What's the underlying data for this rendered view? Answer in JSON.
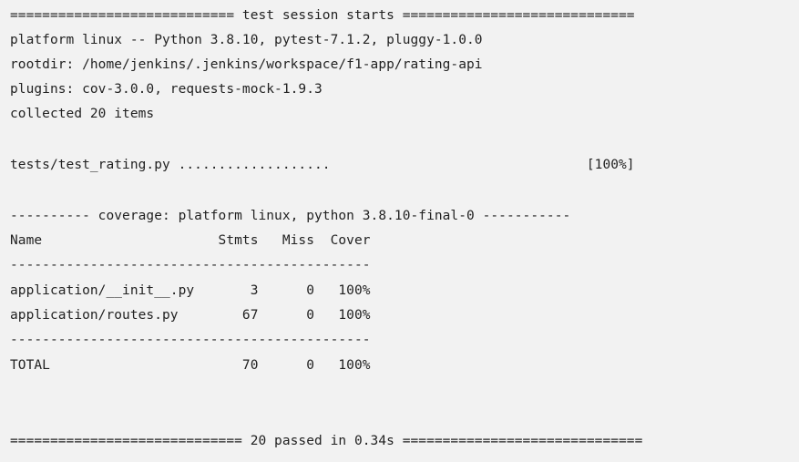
{
  "terminal": {
    "lines": [
      "============================ test session starts =============================",
      "platform linux -- Python 3.8.10, pytest-7.1.2, pluggy-1.0.0",
      "rootdir: /home/jenkins/.jenkins/workspace/f1-app/rating-api",
      "plugins: cov-3.0.0, requests-mock-1.9.3",
      "collected 20 items",
      "tests/test_rating.py ...................                                [100%]",
      "---------- coverage: platform linux, python 3.8.10-final-0 -----------",
      "Name                      Stmts   Miss  Cover",
      "---------------------------------------------",
      "application/__init__.py       3      0   100%",
      "application/routes.py        67      0   100%",
      "---------------------------------------------",
      "TOTAL                        70      0   100%",
      "============================= 20 passed in 0.34s =============================="
    ]
  }
}
